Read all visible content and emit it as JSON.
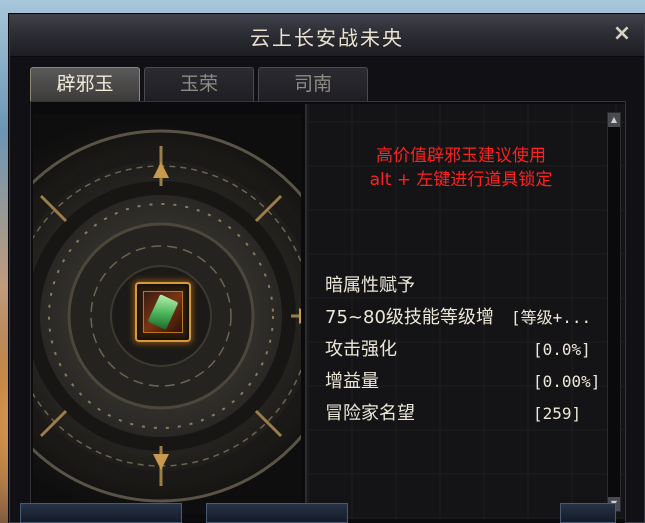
{
  "window": {
    "title": "云上长安战未央",
    "close_glyph": "×"
  },
  "tabs": [
    {
      "label": "辟邪玉",
      "active": true
    },
    {
      "label": "玉荣",
      "active": false
    },
    {
      "label": "司南",
      "active": false
    }
  ],
  "item_slot": {
    "icon": "jade-talisman-icon"
  },
  "info": {
    "warning_line1": "高价值辟邪玉建议使用",
    "warning_line2": "alt + 左键进行道具锁定",
    "warning_color": "#ff2020",
    "stats": [
      {
        "label": "暗属性赋予",
        "value": ""
      },
      {
        "label": "75~80级技能等级增",
        "value": "[等级+..."
      },
      {
        "label": "攻击强化",
        "value": "[0.0%]"
      },
      {
        "label": "增益量",
        "value": "[0.00%]"
      },
      {
        "label": "冒险家名望",
        "value": "[259]"
      }
    ]
  },
  "scrollbar": {
    "up_glyph": "▲",
    "down_glyph": "▼"
  }
}
